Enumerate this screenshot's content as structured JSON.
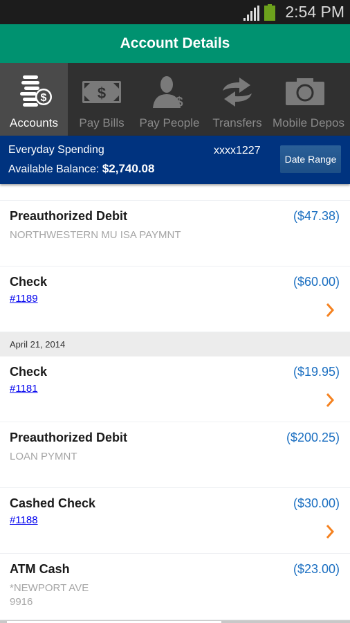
{
  "status_bar": {
    "time": "2:54 PM",
    "signal_icon": "signal-icon",
    "battery_icon": "battery-icon"
  },
  "header": {
    "title": "Account Details"
  },
  "nav_tabs": [
    {
      "label": "Accounts",
      "icon": "coins-dollar-icon",
      "active": true
    },
    {
      "label": "Pay Bills",
      "icon": "banknote-icon",
      "active": false
    },
    {
      "label": "Pay People",
      "icon": "person-dollar-icon",
      "active": false
    },
    {
      "label": "Transfers",
      "icon": "transfer-arrows-icon",
      "active": false
    },
    {
      "label": "Mobile Depos",
      "icon": "camera-icon",
      "active": false
    }
  ],
  "account": {
    "name": "Everyday Spending",
    "number": "xxxx1227",
    "balance_label": "Available Balance:",
    "balance_value": "$2,740.08",
    "date_range_button": "Date Range"
  },
  "transactions_before": [
    {
      "title": "Preauthorized Debit",
      "amount": "($47.38)",
      "detail": "NORTHWESTERN MU  ISA PAYMNT"
    },
    {
      "title": "Check",
      "amount": "($60.00)",
      "check_link": "#1189",
      "has_chevron": true
    }
  ],
  "date_header": "April 21, 2014",
  "transactions_after": [
    {
      "title": "Check",
      "amount": "($19.95)",
      "check_link": "#1181",
      "has_chevron": true
    },
    {
      "title": "Preauthorized Debit",
      "amount": "($200.25)",
      "detail": "LOAN PYMNT"
    },
    {
      "title": "Cashed Check",
      "amount": "($30.00)",
      "check_link": "#1188",
      "has_chevron": true
    },
    {
      "title": "ATM Cash",
      "amount": "($23.00)",
      "detail_lines": [
        "*NEWPORT AVE",
        "9916"
      ]
    }
  ],
  "colors": {
    "header_green": "#009270",
    "account_blue": "#00337f",
    "amount_blue": "#1b6fc1",
    "chevron_orange": "#f58220",
    "battery_green": "#6ca11c"
  }
}
